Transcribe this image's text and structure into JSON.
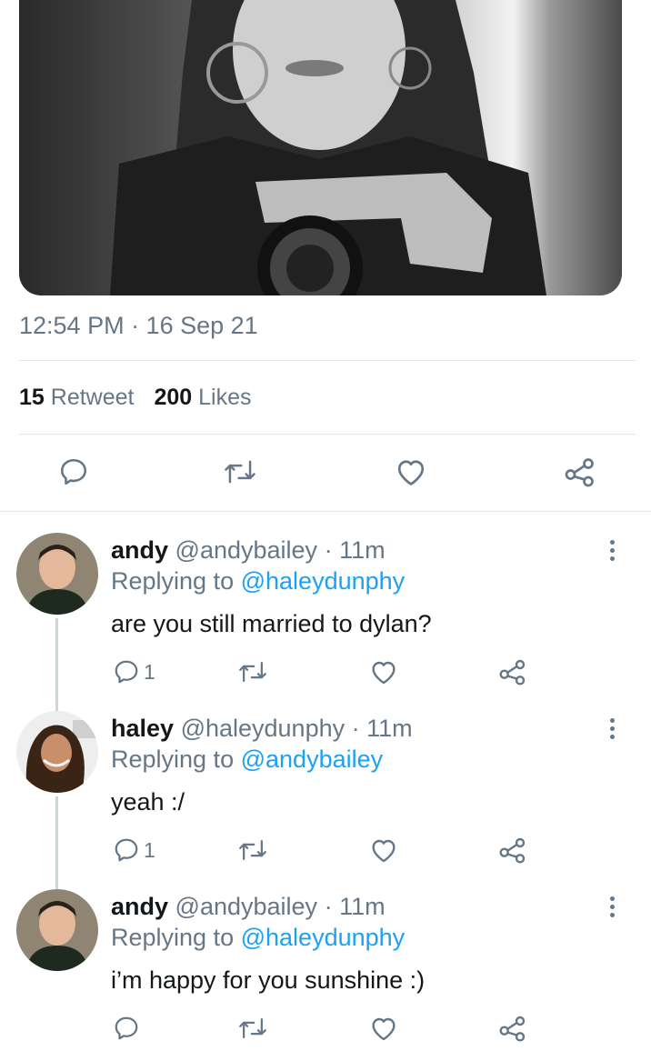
{
  "tweet": {
    "timestamp": "12:54 PM · 16 Sep 21",
    "retweet_count": "15",
    "retweet_label": "Retweet",
    "like_count": "200",
    "like_label": "Likes"
  },
  "replies": [
    {
      "name": "andy",
      "handle": "@andybailey",
      "time": "· 11m",
      "replying_label": "Replying to",
      "replying_to": "@haleydunphy",
      "text": "are you still married to dylan?",
      "reply_count": "1"
    },
    {
      "name": "haley",
      "handle": "@haleydunphy",
      "time": "· 11m",
      "replying_label": "Replying to",
      "replying_to": "@andybailey",
      "text": "yeah :/",
      "reply_count": "1"
    },
    {
      "name": "andy",
      "handle": "@andybailey",
      "time": "· 11m",
      "replying_label": "Replying to",
      "replying_to": "@haleydunphy",
      "text": "i’m happy for you sunshine :)",
      "reply_count": ""
    }
  ],
  "icons": {
    "reply": "speech-bubble-icon",
    "retweet": "retweet-icon",
    "like": "heart-icon",
    "share": "share-icon",
    "more": "more-vertical-icon"
  },
  "colors": {
    "text": "#14171a",
    "secondary": "#657786",
    "mention": "#1da1f2",
    "divider": "#e1e8ed"
  }
}
